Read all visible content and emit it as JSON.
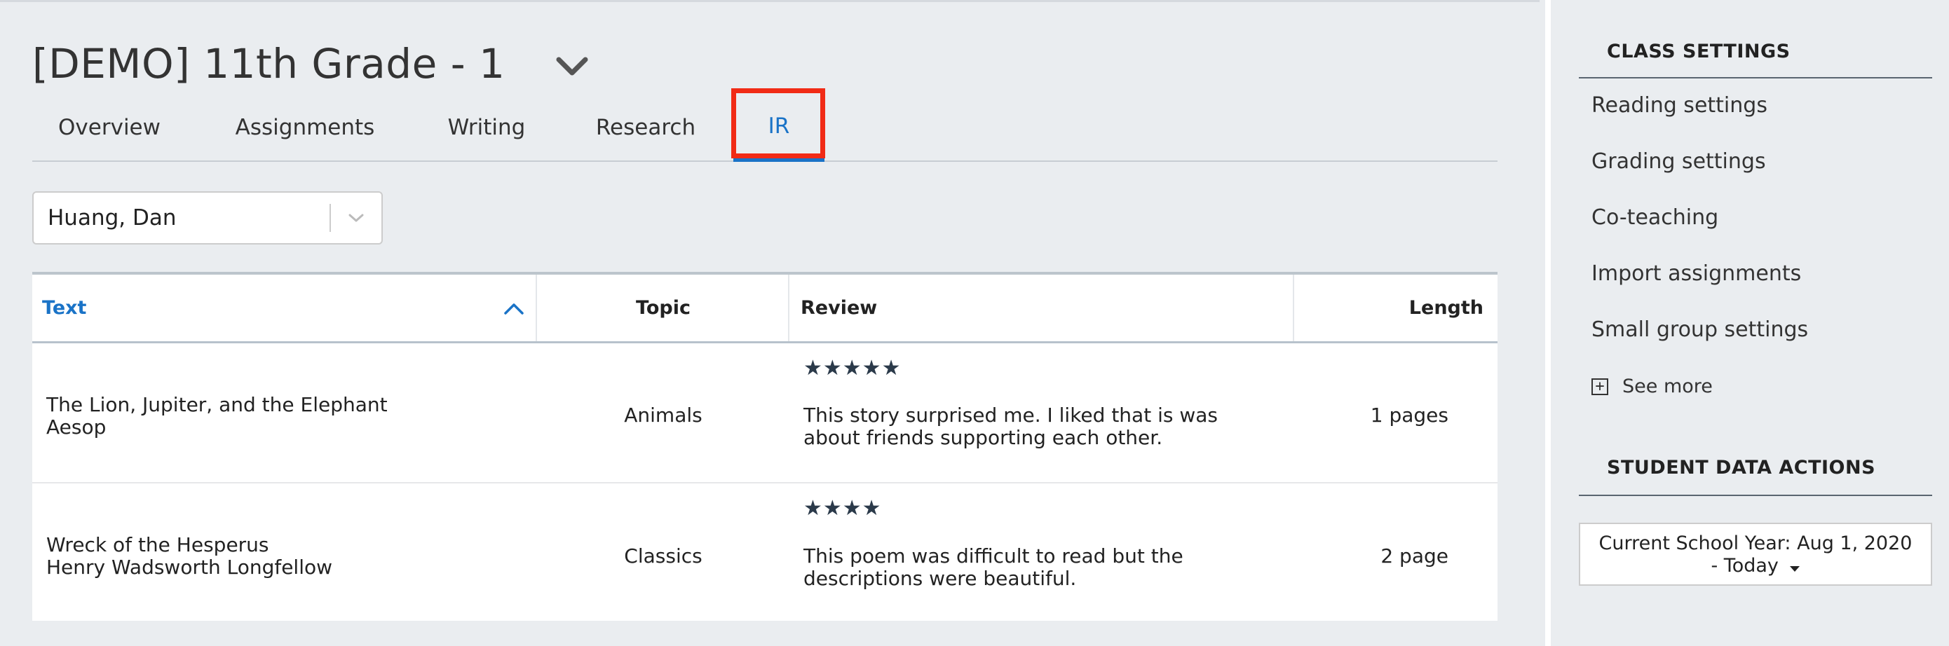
{
  "class_selector": {
    "title": "[DEMO] 11th Grade - 1",
    "chevron_icon": "chevron-down-icon"
  },
  "tabs": [
    {
      "label": "Overview",
      "active": false
    },
    {
      "label": "Assignments",
      "active": false
    },
    {
      "label": "Writing",
      "active": false
    },
    {
      "label": "Research",
      "active": false
    },
    {
      "label": "IR",
      "active": true
    }
  ],
  "student_select": {
    "value": "Huang, Dan",
    "icon": "chevron-down-icon"
  },
  "table": {
    "columns": {
      "text": "Text",
      "topic": "Topic",
      "review": "Review",
      "length": "Length"
    },
    "sort_icon": "chevron-up-icon",
    "rows": [
      {
        "title": "The Lion, Jupiter, and the Elephant",
        "author": "Aesop",
        "topic": "Animals",
        "stars": "★★★★★",
        "rating": 5,
        "review_line1": "This story surprised me. I liked that is was",
        "review_line2": "about friends supporting each other.",
        "length": "1 pages"
      },
      {
        "title": "Wreck of the Hesperus",
        "author": "Henry Wadsworth Longfellow",
        "topic": "Classics",
        "stars": "★★★★",
        "rating": 4,
        "review_line1": "This poem was difficult to read but the",
        "review_line2": "descriptions were beautiful.",
        "length": "2 page"
      }
    ]
  },
  "sidebar": {
    "class_settings_heading": "CLASS SETTINGS",
    "links": [
      "Reading settings",
      "Grading settings",
      "Co-teaching",
      "Import assignments",
      "Small group settings"
    ],
    "see_more": "See more",
    "see_more_icon": "plus-box-icon",
    "student_data_heading": "STUDENT DATA ACTIONS",
    "year_line1": "Current School Year: Aug 1, 2020",
    "year_line2": "- Today",
    "year_icon": "caret-down-icon"
  },
  "colors": {
    "accent": "#1a73c7",
    "highlight": "#f12b16",
    "background": "#eaedf0"
  }
}
